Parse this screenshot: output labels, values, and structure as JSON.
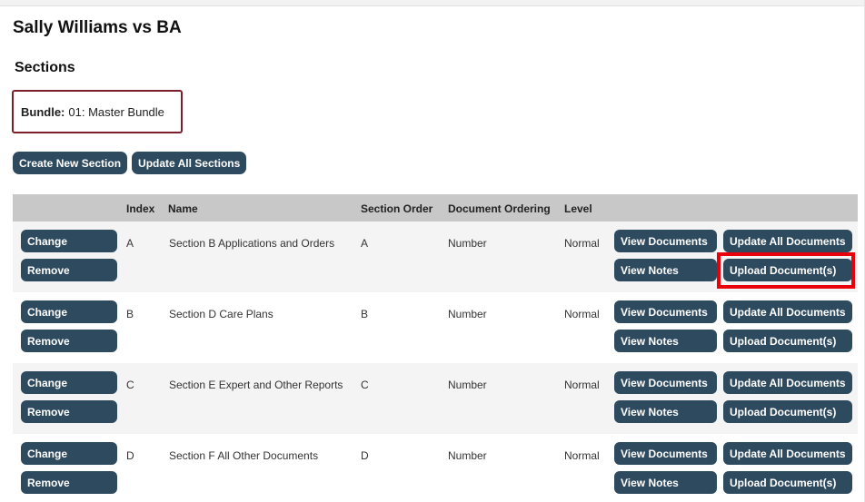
{
  "page": {
    "case_title": "Sally Williams vs BA",
    "sections_heading": "Sections",
    "bundle_label": "Bundle:",
    "bundle_value": "01: Master Bundle"
  },
  "toolbar": {
    "create_label": "Create New Section",
    "update_all_label": "Update All Sections"
  },
  "table": {
    "headers": {
      "index": "Index",
      "name": "Name",
      "section_order": "Section Order",
      "document_ordering": "Document Ordering",
      "level": "Level"
    },
    "rows": [
      {
        "index": "A",
        "name": "Section B Applications and Orders",
        "section_order": "A",
        "document_ordering": "Number",
        "level": "Normal"
      },
      {
        "index": "B",
        "name": "Section D Care Plans",
        "section_order": "B",
        "document_ordering": "Number",
        "level": "Normal"
      },
      {
        "index": "C",
        "name": "Section E Expert and Other Reports",
        "section_order": "C",
        "document_ordering": "Number",
        "level": "Normal"
      },
      {
        "index": "D",
        "name": "Section F All Other Documents",
        "section_order": "D",
        "document_ordering": "Number",
        "level": "Normal"
      }
    ],
    "actions": {
      "change": "Change",
      "remove": "Remove",
      "view_documents": "View Documents",
      "view_notes": "View Notes",
      "update_all_documents": "Update All Documents",
      "upload_documents": "Upload Document(s)"
    }
  },
  "colors": {
    "button_bg": "#2e4a5f",
    "header_bg": "#c8c8c8",
    "bundle_border": "#7a1f2b",
    "highlight": "#e8000b"
  }
}
